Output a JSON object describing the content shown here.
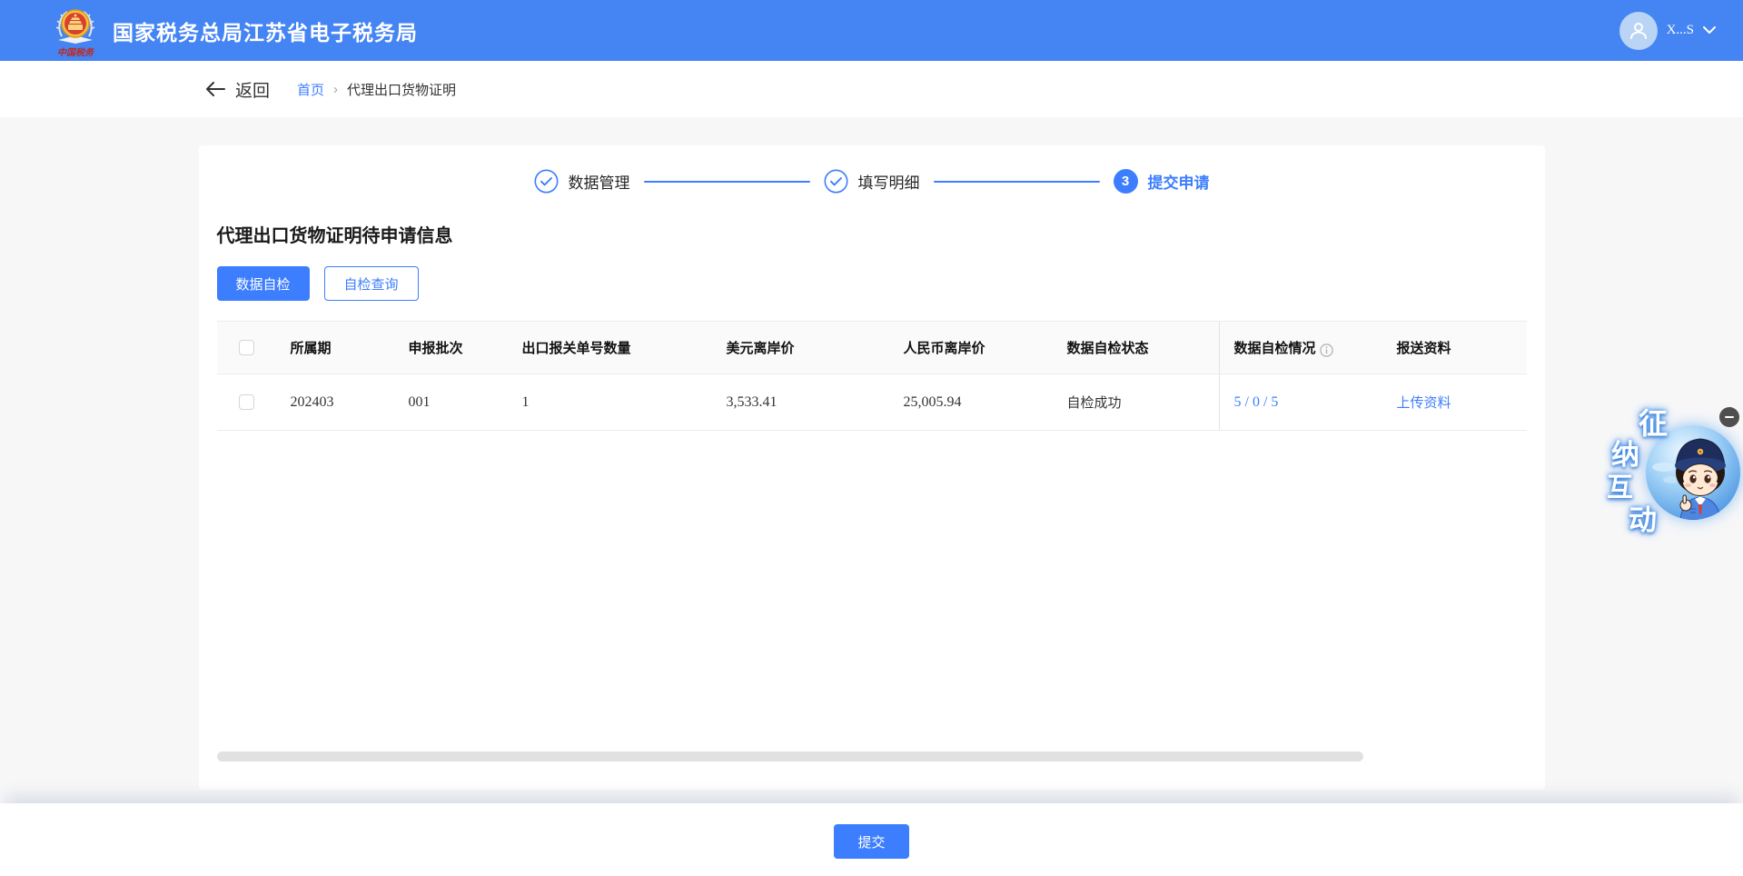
{
  "colors": {
    "header_bg": "#4484F3",
    "accent": "#3D7EFE",
    "link": "#3D7EFE",
    "page_bg": "#F7F7F8",
    "card_bg": "#FFFFFF",
    "table_header_bg": "#FAFAFA",
    "table_border": "#ECECEC",
    "scrollbar": "#E1E1E1",
    "minimize_bg": "#4F4F4F"
  },
  "header": {
    "title": "国家税务总局江苏省电子税务局",
    "logo_caption": "中国税务",
    "user_name": "X...S"
  },
  "nav": {
    "back_label": "返回",
    "breadcrumb": [
      "首页",
      "代理出口货物证明"
    ],
    "separator": "›"
  },
  "steps": [
    {
      "label": "数据管理",
      "state": "done"
    },
    {
      "label": "填写明细",
      "state": "done"
    },
    {
      "label": "提交申请",
      "state": "active",
      "number": "3"
    }
  ],
  "section": {
    "title": "代理出口货物证明待申请信息",
    "self_check_label": "数据自检",
    "query_label": "自检查询"
  },
  "table": {
    "columns": [
      "所属期",
      "申报批次",
      "出口报关单号数量",
      "美元离岸价",
      "人民币离岸价",
      "数据自检状态",
      "数据自检情况",
      "报送资料"
    ],
    "rows": [
      {
        "period": "202403",
        "batch": "001",
        "declaration_count": "1",
        "usd_fob": "3,533.41",
        "rmb_fob": "25,005.94",
        "status": "自检成功",
        "check_detail": "5 / 0 / 5",
        "upload_label": "上传资料"
      }
    ]
  },
  "footer": {
    "submit_label": "提交"
  },
  "widget": {
    "chars": [
      "征",
      "纳",
      "互",
      "动"
    ]
  }
}
